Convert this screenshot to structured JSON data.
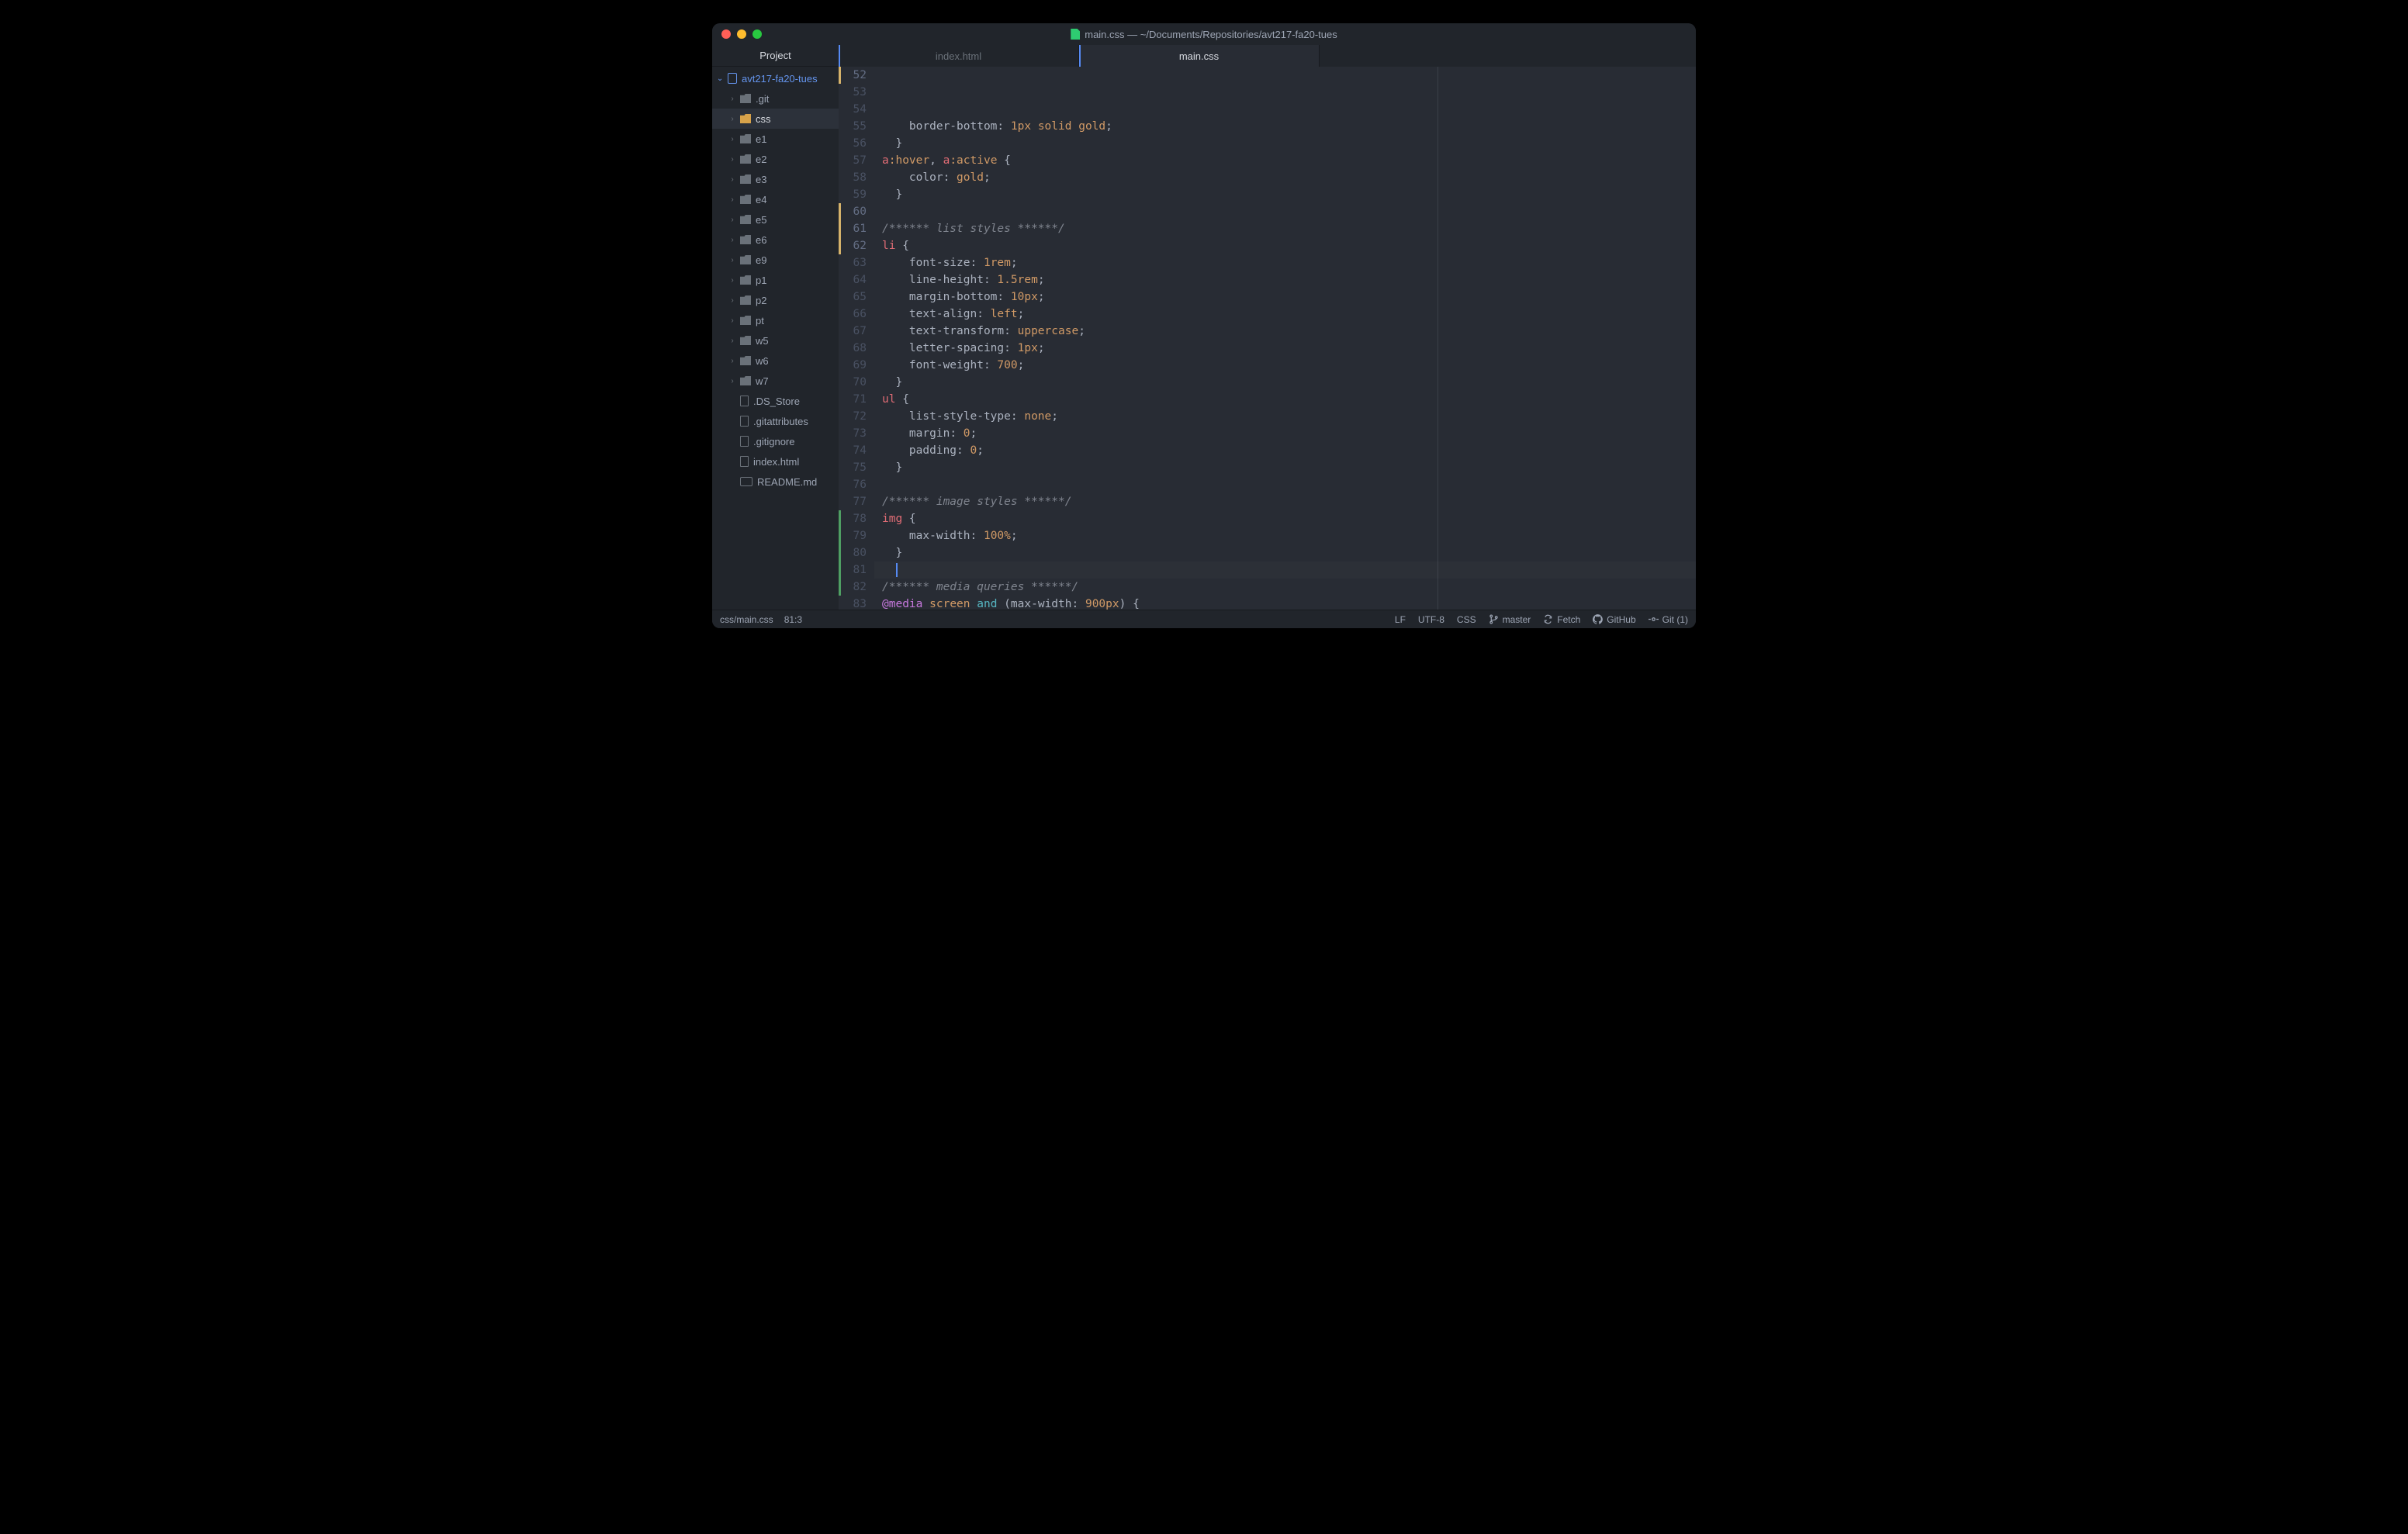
{
  "titlebar": {
    "title": "main.css — ~/Documents/Repositories/avt217-fa20-tues"
  },
  "sidebar": {
    "header": "Project",
    "root": {
      "label": "avt217-fa20-tues",
      "expanded": true
    },
    "items": [
      {
        "label": ".git",
        "type": "folder"
      },
      {
        "label": "css",
        "type": "folder",
        "selected": true
      },
      {
        "label": "e1",
        "type": "folder"
      },
      {
        "label": "e2",
        "type": "folder"
      },
      {
        "label": "e3",
        "type": "folder"
      },
      {
        "label": "e4",
        "type": "folder"
      },
      {
        "label": "e5",
        "type": "folder"
      },
      {
        "label": "e6",
        "type": "folder"
      },
      {
        "label": "e9",
        "type": "folder"
      },
      {
        "label": "p1",
        "type": "folder"
      },
      {
        "label": "p2",
        "type": "folder"
      },
      {
        "label": "pt",
        "type": "folder"
      },
      {
        "label": "w5",
        "type": "folder"
      },
      {
        "label": "w6",
        "type": "folder"
      },
      {
        "label": "w7",
        "type": "folder"
      },
      {
        "label": ".DS_Store",
        "type": "file"
      },
      {
        "label": ".gitattributes",
        "type": "file"
      },
      {
        "label": ".gitignore",
        "type": "file"
      },
      {
        "label": "index.html",
        "type": "file"
      },
      {
        "label": "README.md",
        "type": "md"
      }
    ]
  },
  "tabs": [
    {
      "label": "index.html",
      "active": false,
      "modified": true
    },
    {
      "label": "main.css",
      "active": true,
      "modified": true
    }
  ],
  "editor": {
    "first_line": 52,
    "cursor_line": 81,
    "cursor_col": 3,
    "wrap_guide_col": 80,
    "lines": [
      {
        "n": 52,
        "git": "mod",
        "tokens": [
          [
            "    ",
            "c-punc"
          ],
          [
            "border-bottom",
            "c-prop"
          ],
          [
            ": ",
            "c-punc"
          ],
          [
            "1px",
            "c-num"
          ],
          [
            " ",
            "c-punc"
          ],
          [
            "solid",
            "c-kw"
          ],
          [
            " ",
            "c-punc"
          ],
          [
            "gold",
            "c-kw"
          ],
          [
            ";",
            "c-punc"
          ]
        ]
      },
      {
        "n": 53,
        "tokens": [
          [
            "  }",
            "c-punc"
          ]
        ]
      },
      {
        "n": 54,
        "tokens": [
          [
            "a",
            "c-tag"
          ],
          [
            ":hover",
            "c-pseudo"
          ],
          [
            ", ",
            "c-comma"
          ],
          [
            "a",
            "c-tag"
          ],
          [
            ":active",
            "c-pseudo"
          ],
          [
            " {",
            "c-punc"
          ]
        ]
      },
      {
        "n": 55,
        "tokens": [
          [
            "    ",
            "c-punc"
          ],
          [
            "color",
            "c-prop"
          ],
          [
            ": ",
            "c-punc"
          ],
          [
            "gold",
            "c-kw"
          ],
          [
            ";",
            "c-punc"
          ]
        ]
      },
      {
        "n": 56,
        "tokens": [
          [
            "  }",
            "c-punc"
          ]
        ]
      },
      {
        "n": 57,
        "tokens": [
          [
            "",
            "c-punc"
          ]
        ]
      },
      {
        "n": 58,
        "tokens": [
          [
            "/****** list styles ******/",
            "c-comment"
          ]
        ]
      },
      {
        "n": 59,
        "tokens": [
          [
            "li",
            "c-tag"
          ],
          [
            " {",
            "c-punc"
          ]
        ]
      },
      {
        "n": 60,
        "git": "mod",
        "tokens": [
          [
            "    ",
            "c-punc"
          ],
          [
            "font-size",
            "c-prop"
          ],
          [
            ": ",
            "c-punc"
          ],
          [
            "1rem",
            "c-num"
          ],
          [
            ";",
            "c-punc"
          ]
        ]
      },
      {
        "n": 61,
        "git": "mod",
        "tokens": [
          [
            "    ",
            "c-punc"
          ],
          [
            "line-height",
            "c-prop"
          ],
          [
            ": ",
            "c-punc"
          ],
          [
            "1.5rem",
            "c-num"
          ],
          [
            ";",
            "c-punc"
          ]
        ]
      },
      {
        "n": 62,
        "git": "mod",
        "tokens": [
          [
            "    ",
            "c-punc"
          ],
          [
            "margin-bottom",
            "c-prop"
          ],
          [
            ": ",
            "c-punc"
          ],
          [
            "10px",
            "c-num"
          ],
          [
            ";",
            "c-punc"
          ]
        ]
      },
      {
        "n": 63,
        "tokens": [
          [
            "    ",
            "c-punc"
          ],
          [
            "text-align",
            "c-prop"
          ],
          [
            ": ",
            "c-punc"
          ],
          [
            "left",
            "c-kw"
          ],
          [
            ";",
            "c-punc"
          ]
        ]
      },
      {
        "n": 64,
        "tokens": [
          [
            "    ",
            "c-punc"
          ],
          [
            "text-transform",
            "c-prop"
          ],
          [
            ": ",
            "c-punc"
          ],
          [
            "uppercase",
            "c-kw"
          ],
          [
            ";",
            "c-punc"
          ]
        ]
      },
      {
        "n": 65,
        "tokens": [
          [
            "    ",
            "c-punc"
          ],
          [
            "letter-spacing",
            "c-prop"
          ],
          [
            ": ",
            "c-punc"
          ],
          [
            "1px",
            "c-num"
          ],
          [
            ";",
            "c-punc"
          ]
        ]
      },
      {
        "n": 66,
        "tokens": [
          [
            "    ",
            "c-punc"
          ],
          [
            "font-weight",
            "c-prop"
          ],
          [
            ": ",
            "c-punc"
          ],
          [
            "700",
            "c-num"
          ],
          [
            ";",
            "c-punc"
          ]
        ]
      },
      {
        "n": 67,
        "tokens": [
          [
            "  }",
            "c-punc"
          ]
        ]
      },
      {
        "n": 68,
        "tokens": [
          [
            "ul",
            "c-tag"
          ],
          [
            " {",
            "c-punc"
          ]
        ]
      },
      {
        "n": 69,
        "tokens": [
          [
            "    ",
            "c-punc"
          ],
          [
            "list-style-type",
            "c-prop"
          ],
          [
            ": ",
            "c-punc"
          ],
          [
            "none",
            "c-kw"
          ],
          [
            ";",
            "c-punc"
          ]
        ]
      },
      {
        "n": 70,
        "tokens": [
          [
            "    ",
            "c-punc"
          ],
          [
            "margin",
            "c-prop"
          ],
          [
            ": ",
            "c-punc"
          ],
          [
            "0",
            "c-num"
          ],
          [
            ";",
            "c-punc"
          ]
        ]
      },
      {
        "n": 71,
        "tokens": [
          [
            "    ",
            "c-punc"
          ],
          [
            "padding",
            "c-prop"
          ],
          [
            ": ",
            "c-punc"
          ],
          [
            "0",
            "c-num"
          ],
          [
            ";",
            "c-punc"
          ]
        ]
      },
      {
        "n": 72,
        "tokens": [
          [
            "  }",
            "c-punc"
          ]
        ]
      },
      {
        "n": 73,
        "tokens": [
          [
            "",
            "c-punc"
          ]
        ]
      },
      {
        "n": 74,
        "tokens": [
          [
            "/****** image styles ******/",
            "c-comment"
          ]
        ]
      },
      {
        "n": 75,
        "tokens": [
          [
            "img",
            "c-tag"
          ],
          [
            " {",
            "c-punc"
          ]
        ]
      },
      {
        "n": 76,
        "tokens": [
          [
            "    ",
            "c-punc"
          ],
          [
            "max-width",
            "c-prop"
          ],
          [
            ": ",
            "c-punc"
          ],
          [
            "100%",
            "c-num"
          ],
          [
            ";",
            "c-punc"
          ]
        ]
      },
      {
        "n": 77,
        "tokens": [
          [
            "  }",
            "c-punc"
          ]
        ]
      },
      {
        "n": 78,
        "git": "add",
        "tokens": [
          [
            "",
            "c-punc"
          ]
        ]
      },
      {
        "n": 79,
        "git": "add",
        "tokens": [
          [
            "/****** media queries ******/",
            "c-comment"
          ]
        ]
      },
      {
        "n": 80,
        "git": "add",
        "tokens": [
          [
            "@media",
            "c-at"
          ],
          [
            " ",
            "c-punc"
          ],
          [
            "screen",
            "c-attr"
          ],
          [
            " ",
            "c-punc"
          ],
          [
            "and",
            "c-func"
          ],
          [
            " (",
            "c-punc"
          ],
          [
            "max-width",
            "c-prop"
          ],
          [
            ": ",
            "c-punc"
          ],
          [
            "900px",
            "c-num"
          ],
          [
            ") {",
            "c-punc"
          ]
        ]
      },
      {
        "n": 81,
        "git": "add",
        "tokens": [
          [
            "  ",
            "c-punc"
          ]
        ]
      },
      {
        "n": 82,
        "git": "add",
        "tokens": [
          [
            "  }",
            "c-punc"
          ]
        ]
      },
      {
        "n": 83,
        "tokens": [
          [
            "",
            "c-punc"
          ]
        ]
      }
    ]
  },
  "statusbar": {
    "path": "css/main.css",
    "cursor": "81:3",
    "line_ending": "LF",
    "encoding": "UTF-8",
    "grammar": "CSS",
    "branch": "master",
    "fetch": "Fetch",
    "github": "GitHub",
    "git": "Git (1)"
  }
}
